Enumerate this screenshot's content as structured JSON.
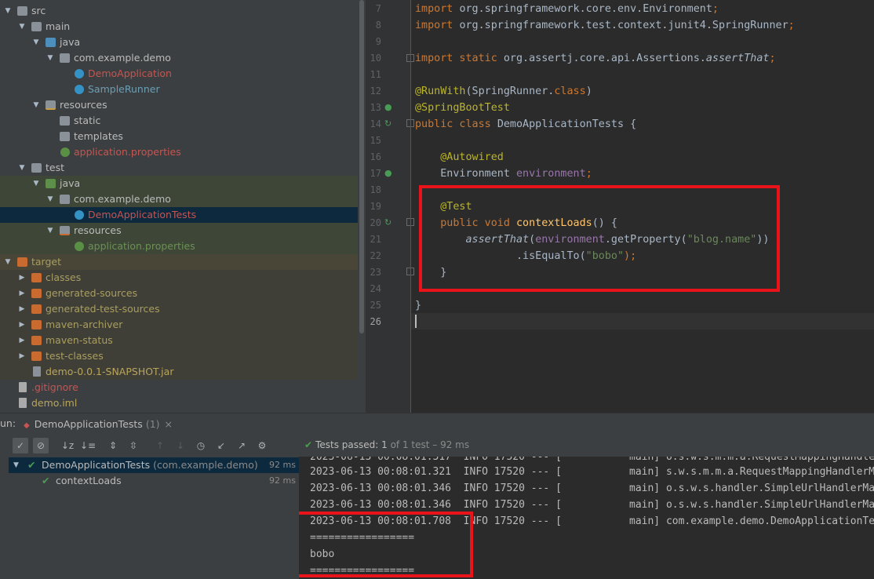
{
  "project_tree": {
    "items": [
      {
        "label": "src",
        "icon": "folder-icon"
      },
      {
        "label": "main",
        "icon": "folder-icon"
      },
      {
        "label": "java",
        "icon": "source-folder-icon"
      },
      {
        "label": "com.example.demo",
        "icon": "package-icon"
      },
      {
        "label": "DemoApplication",
        "icon": "spring-class-icon"
      },
      {
        "label": "SampleRunner",
        "icon": "class-icon"
      },
      {
        "label": "resources",
        "icon": "resources-folder-icon"
      },
      {
        "label": "static",
        "icon": "folder-icon"
      },
      {
        "label": "templates",
        "icon": "folder-icon"
      },
      {
        "label": "application.properties",
        "icon": "properties-file-icon"
      },
      {
        "label": "test",
        "icon": "folder-icon"
      },
      {
        "label": "java",
        "icon": "test-source-folder-icon"
      },
      {
        "label": "com.example.demo",
        "icon": "package-icon"
      },
      {
        "label": "DemoApplicationTests",
        "icon": "spring-class-icon"
      },
      {
        "label": "resources",
        "icon": "test-resources-folder-icon"
      },
      {
        "label": "application.properties",
        "icon": "properties-file-icon"
      },
      {
        "label": "target",
        "icon": "excluded-folder-icon"
      },
      {
        "label": "classes",
        "icon": "excluded-folder-icon"
      },
      {
        "label": "generated-sources",
        "icon": "excluded-folder-icon"
      },
      {
        "label": "generated-test-sources",
        "icon": "excluded-folder-icon"
      },
      {
        "label": "maven-archiver",
        "icon": "excluded-folder-icon"
      },
      {
        "label": "maven-status",
        "icon": "excluded-folder-icon"
      },
      {
        "label": "test-classes",
        "icon": "excluded-folder-icon"
      },
      {
        "label": "demo-0.0.1-SNAPSHOT.jar",
        "icon": "jar-file-icon"
      },
      {
        "label": ".gitignore",
        "icon": "file-icon"
      },
      {
        "label": "demo.iml",
        "icon": "file-icon"
      }
    ]
  },
  "editor": {
    "line_numbers": [
      "7",
      "8",
      "9",
      "10",
      "11",
      "12",
      "13",
      "14",
      "15",
      "16",
      "17",
      "18",
      "19",
      "20",
      "21",
      "22",
      "23",
      "24",
      "25",
      "26"
    ],
    "lines": [
      [
        {
          "t": "import ",
          "c": "k"
        },
        {
          "t": "org.springframework.core.env.Environment",
          "c": ""
        },
        {
          "t": ";",
          "c": "k"
        }
      ],
      [
        {
          "t": "import ",
          "c": "k"
        },
        {
          "t": "org.springframework.test.context.junit4.SpringRunner",
          "c": ""
        },
        {
          "t": ";",
          "c": "k"
        }
      ],
      [],
      [
        {
          "t": "import static ",
          "c": "k"
        },
        {
          "t": "org.assertj.core.api.Assertions.",
          "c": ""
        },
        {
          "t": "assertThat",
          "c": "it"
        },
        {
          "t": ";",
          "c": "k"
        }
      ],
      [],
      [
        {
          "t": "@RunWith",
          "c": "an"
        },
        {
          "t": "(SpringRunner.",
          "c": ""
        },
        {
          "t": "class",
          "c": "k"
        },
        {
          "t": ")",
          "c": ""
        }
      ],
      [
        {
          "t": "@SpringBootTest",
          "c": "an"
        }
      ],
      [
        {
          "t": "public class ",
          "c": "k"
        },
        {
          "t": "DemoApplicationTests {",
          "c": ""
        }
      ],
      [],
      [
        {
          "t": "    ",
          "c": ""
        },
        {
          "t": "@Autowired",
          "c": "an"
        }
      ],
      [
        {
          "t": "    Environment ",
          "c": ""
        },
        {
          "t": "environment",
          "c": "fd"
        },
        {
          "t": ";",
          "c": "k"
        }
      ],
      [],
      [
        {
          "t": "    ",
          "c": ""
        },
        {
          "t": "@Test",
          "c": "an"
        }
      ],
      [
        {
          "t": "    ",
          "c": ""
        },
        {
          "t": "public void ",
          "c": "k"
        },
        {
          "t": "contextLoads",
          "c": "fn"
        },
        {
          "t": "() {",
          "c": ""
        }
      ],
      [
        {
          "t": "        ",
          "c": ""
        },
        {
          "t": "assertThat",
          "c": "it"
        },
        {
          "t": "(",
          "c": ""
        },
        {
          "t": "environment",
          "c": "fd"
        },
        {
          "t": ".getProperty(",
          "c": ""
        },
        {
          "t": "\"blog.name\"",
          "c": "st"
        },
        {
          "t": "))",
          "c": ""
        }
      ],
      [
        {
          "t": "                .isEqualTo(",
          "c": ""
        },
        {
          "t": "\"bobo\"",
          "c": "st"
        },
        {
          "t": ");",
          "c": "k"
        }
      ],
      [
        {
          "t": "    }",
          "c": ""
        }
      ],
      [],
      [
        {
          "t": "}",
          "c": ""
        }
      ],
      []
    ]
  },
  "run_panel": {
    "label": "un:",
    "tab_title": "DemoApplicationTests",
    "tab_count": "(1)",
    "tab_close": "×",
    "status_prefix": "Tests passed:",
    "status_passed": "1",
    "status_rest": "of 1 test – 92 ms",
    "tests": [
      {
        "name": "DemoApplicationTests",
        "package": "(com.example.demo)",
        "time": "92 ms"
      },
      {
        "name": "contextLoads",
        "package": "",
        "time": "92 ms"
      }
    ],
    "console_lines": [
      "2023-06-13 00:08:01.317  INFO 17520 --- [           main] o.s.w.s.m.m.a.RequestMappingHandlerAdapter",
      "2023-06-13 00:08:01.321  INFO 17520 --- [           main] s.w.s.m.m.a.RequestMappingHandlerMapping",
      "2023-06-13 00:08:01.346  INFO 17520 --- [           main] o.s.w.s.handler.SimpleUrlHandlerMapping",
      "2023-06-13 00:08:01.346  INFO 17520 --- [           main] o.s.w.s.handler.SimpleUrlHandlerMapping",
      "2023-06-13 00:08:01.708  INFO 17520 --- [           main] com.example.demo.DemoApplicationTests",
      "=================",
      "bobo",
      "================="
    ]
  },
  "colors": {
    "highlight_box": "#e8141a",
    "pass_green": "#499c54",
    "modified_red": "#c75450"
  }
}
